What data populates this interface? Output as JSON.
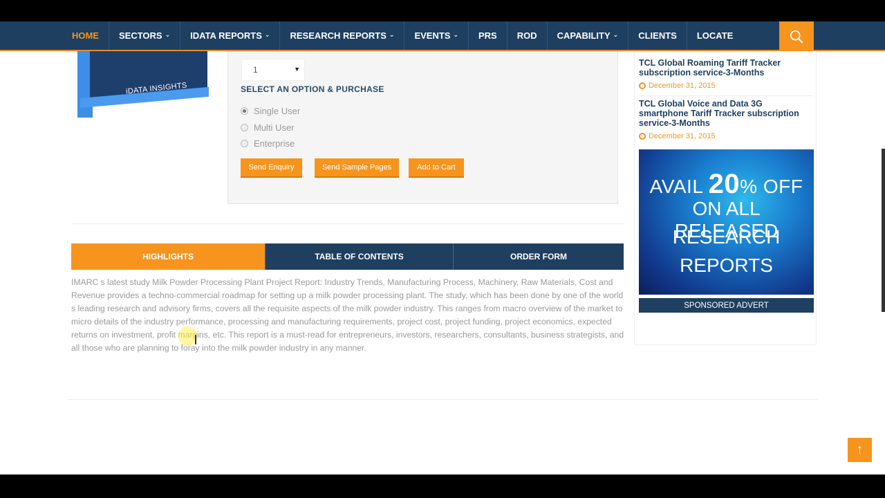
{
  "nav": {
    "items": [
      {
        "label": "HOME",
        "dropdown": false,
        "active": true
      },
      {
        "label": "SECTORS",
        "dropdown": true,
        "active": false
      },
      {
        "label": "IDATA REPORTS",
        "dropdown": true,
        "active": false
      },
      {
        "label": "RESEARCH REPORTS",
        "dropdown": true,
        "active": false
      },
      {
        "label": "EVENTS",
        "dropdown": true,
        "active": false
      },
      {
        "label": "PRS",
        "dropdown": false,
        "active": false
      },
      {
        "label": "ROD",
        "dropdown": false,
        "active": false
      },
      {
        "label": "CAPABILITY",
        "dropdown": true,
        "active": false
      },
      {
        "label": "CLIENTS",
        "dropdown": false,
        "active": false
      },
      {
        "label": "LOCATE",
        "dropdown": false,
        "active": false
      }
    ],
    "search_icon": "search-icon",
    "chevron": "⌵"
  },
  "product": {
    "box_label": "iDATA INSIGHTS"
  },
  "options": {
    "quantity_value": "1",
    "title": "SELECT AN OPTION & PURCHASE",
    "license_options": [
      {
        "label": "Single User",
        "checked": true
      },
      {
        "label": "Multi User",
        "checked": false
      },
      {
        "label": "Enterprise",
        "checked": false
      }
    ],
    "buttons": {
      "send_enquiry": "Send Enquiry",
      "send_sample": "Send Sample Pages",
      "add_to_cart": "Add to Cart"
    }
  },
  "tabs": [
    {
      "label": "HIGHLIGHTS",
      "active": true
    },
    {
      "label": "TABLE OF CONTENTS",
      "active": false
    },
    {
      "label": "ORDER FORM",
      "active": false
    }
  ],
  "highlights": {
    "text": "IMARC s latest study  Milk Powder Processing Plant Project Report: Industry Trends, Manufacturing Process, Machinery, Raw Materials, Cost and Revenue provides a techno-commercial roadmap for setting up a milk powder processing plant. The study, which has been done by one of the world s leading research and advisory firms, covers all the requisite aspects of the milk powder industry. This ranges from macro overview of the market to micro details of the industry performance, processing and manufacturing requirements, project cost, project funding, project economics, expected returns on investment, profit margins, etc. This report is a must-read for entrepreneurs, investors, researchers, consultants, business strategists, and all those who are planning to foray into the milk powder industry in any manner."
  },
  "sidebar": {
    "items": [
      {
        "title": "TCL Global Roaming Tariff Tracker subscription service-3-Months",
        "date": "December 31, 2015"
      },
      {
        "title": "TCL Global Voice and Data 3G smartphone Tariff Tracker subscription service-3-Months",
        "date": "December 31, 2015"
      }
    ],
    "ad": {
      "line1_pre": "AVAIL",
      "line1_num": "20",
      "line1_post": "% OFF",
      "line2": "ON ALL RELEASED",
      "line3": "RESEARCH",
      "line4": "REPORTS"
    },
    "sponsored_label": "SPONSORED ADVERT"
  },
  "scroll_top": {
    "icon": "arrow-up-icon",
    "glyph": "↑"
  },
  "colors": {
    "navy": "#1e3f5f",
    "orange": "#f7941d"
  }
}
